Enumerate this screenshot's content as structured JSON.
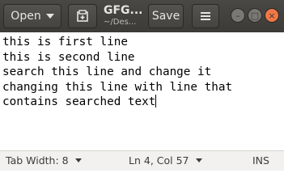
{
  "header": {
    "open_label": "Open",
    "title": "GFG...",
    "subtitle": "~/Des...",
    "save_label": "Save"
  },
  "window_controls": {
    "minimize": "–",
    "maximize": "□",
    "close": "×"
  },
  "editor": {
    "lines": [
      "this is first line",
      "this is second line",
      "search this line and change it",
      "changing this line with line that",
      "contains searched text"
    ]
  },
  "status": {
    "tab_width": "Tab Width: 8",
    "position": "Ln 4, Col 57",
    "mode": "INS"
  },
  "colors": {
    "titlebar": "#3c3b37",
    "close_button": "#f07746",
    "statusbar": "#f2f1f0"
  }
}
